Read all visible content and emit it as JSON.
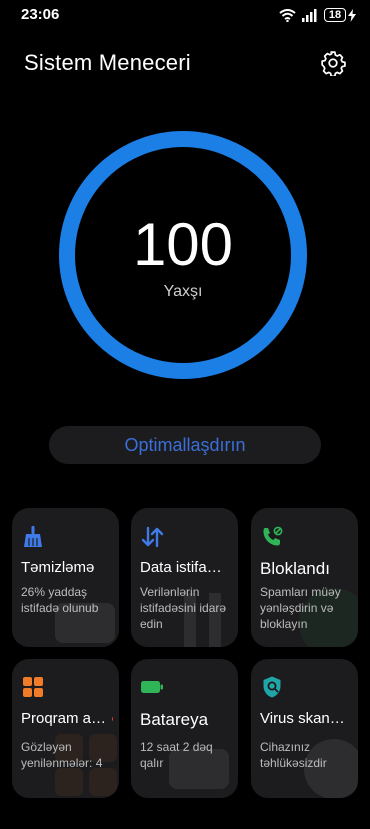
{
  "status": {
    "time": "23:06",
    "battery": "18"
  },
  "header": {
    "title": "Sistem Meneceri"
  },
  "score": {
    "value": "100",
    "label": "Yaxşı",
    "ring_level": 1.0
  },
  "optimize": {
    "label": "Optimallaşdırın"
  },
  "cards": [
    {
      "title": "Təmizləmə",
      "desc": "26% yaddaş istifadə olunub"
    },
    {
      "title": "Data istifa…",
      "desc": "Verilənlərin istifadəsini idarə edin"
    },
    {
      "title": "Bloklandı",
      "desc": "Spamları müəy yənləşdirin və bloklayın"
    },
    {
      "title": "Proqram a…",
      "desc": "Gözləyən yenilənmələr: 4"
    },
    {
      "title": "Batareya",
      "desc": "12 saat 2 dəq qalır"
    },
    {
      "title": "Virus skan…",
      "desc": "Cihazınız təhlükəsizdir"
    }
  ],
  "colors": {
    "accent_blue": "#1b7fe6",
    "green": "#2fb457",
    "orange": "#f07c2a",
    "optimize_text": "#3a6fd8"
  },
  "icons": [
    "broom-icon",
    "data-arrows-icon",
    "phone-block-icon",
    "apps-grid-icon",
    "battery-icon",
    "shield-scan-icon"
  ]
}
